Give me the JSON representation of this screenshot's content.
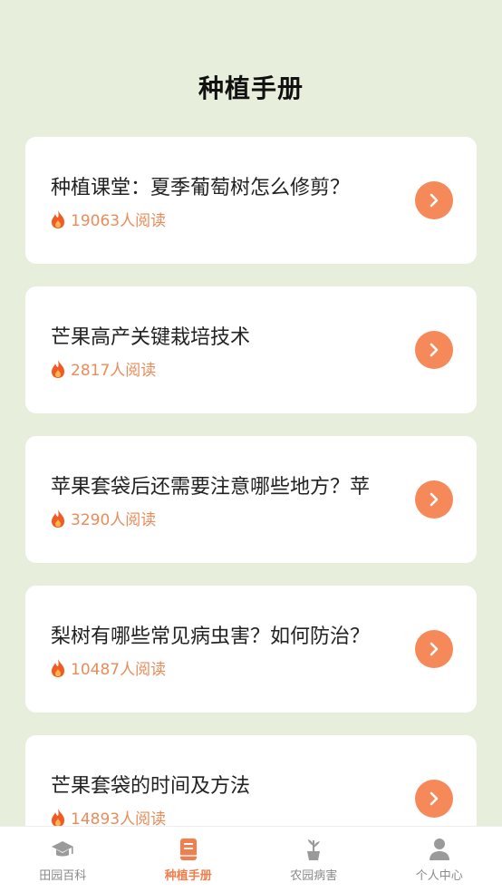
{
  "header": {
    "title": "种植手册"
  },
  "articles": [
    {
      "title": "种植课堂：夏季葡萄树怎么修剪？",
      "reads": "19063人阅读"
    },
    {
      "title": "芒果高产关键栽培技术",
      "reads": "2817人阅读"
    },
    {
      "title": "苹果套袋后还需要注意哪些地方？苹",
      "reads": "3290人阅读"
    },
    {
      "title": "梨树有哪些常见病虫害？如何防治？",
      "reads": "10487人阅读"
    },
    {
      "title": "芒果套袋的时间及方法",
      "reads": "14893人阅读"
    }
  ],
  "tabbar": {
    "tabs": [
      {
        "label": "田园百科",
        "icon": "graduation-cap-icon"
      },
      {
        "label": "种植手册",
        "icon": "book-icon"
      },
      {
        "label": "农园病害",
        "icon": "potted-plant-icon"
      },
      {
        "label": "个人中心",
        "icon": "person-icon"
      }
    ],
    "active_index": 1
  },
  "colors": {
    "background": "#e7eedb",
    "accent": "#f6895a",
    "read_count": "#e98c5a"
  }
}
